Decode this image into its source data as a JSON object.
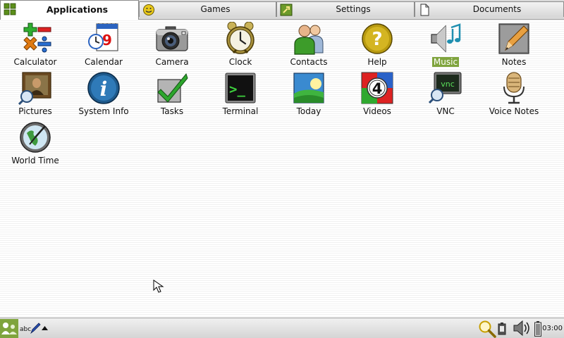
{
  "tabs": [
    {
      "label": "Applications",
      "active": true
    },
    {
      "label": "Games",
      "active": false
    },
    {
      "label": "Settings",
      "active": false
    },
    {
      "label": "Documents",
      "active": false
    }
  ],
  "apps": [
    {
      "label": "Calculator",
      "icon": "calculator-icon"
    },
    {
      "label": "Calendar",
      "icon": "calendar-icon",
      "day": "9"
    },
    {
      "label": "Camera",
      "icon": "camera-icon"
    },
    {
      "label": "Clock",
      "icon": "clock-icon"
    },
    {
      "label": "Contacts",
      "icon": "contacts-icon"
    },
    {
      "label": "Help",
      "icon": "help-icon",
      "glyph": "?"
    },
    {
      "label": "Music",
      "icon": "music-icon",
      "selected": true
    },
    {
      "label": "Notes",
      "icon": "notes-icon"
    },
    {
      "label": "Pictures",
      "icon": "pictures-icon"
    },
    {
      "label": "System Info",
      "icon": "system-info-icon",
      "glyph": "i"
    },
    {
      "label": "Tasks",
      "icon": "tasks-icon"
    },
    {
      "label": "Terminal",
      "icon": "terminal-icon",
      "glyph": ">_"
    },
    {
      "label": "Today",
      "icon": "today-icon"
    },
    {
      "label": "Videos",
      "icon": "videos-icon",
      "glyph": "4"
    },
    {
      "label": "VNC",
      "icon": "vnc-icon",
      "glyph": "vnc"
    },
    {
      "label": "Voice Notes",
      "icon": "voice-notes-icon"
    },
    {
      "label": "World Time",
      "icon": "world-time-icon"
    }
  ],
  "taskbar": {
    "input_method_label": "abc",
    "clock": "03:00"
  },
  "colors": {
    "selection": "#7fa43d",
    "tab_bar": "#d9d9d9",
    "taskbar": "#d4d4d4"
  }
}
